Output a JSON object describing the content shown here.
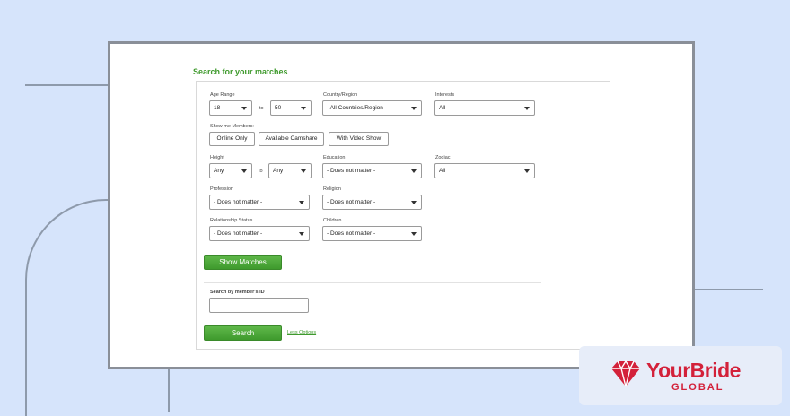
{
  "page": {
    "title": "Search for your matches"
  },
  "filters": {
    "age_range": {
      "label": "Age Range",
      "from": "18",
      "to_text": "to",
      "to": "50"
    },
    "country": {
      "label": "Country/Region",
      "value": "- All Countries/Region -"
    },
    "interests": {
      "label": "Interests",
      "value": "All"
    },
    "show_members": {
      "label": "Show me Members:",
      "options": [
        "Online Only",
        "Available Camshare",
        "With Video Show"
      ]
    },
    "height": {
      "label": "Height",
      "from": "Any",
      "to_text": "to",
      "to": "Any"
    },
    "education": {
      "label": "Education",
      "value": "- Does not matter -"
    },
    "zodiac": {
      "label": "Zodiac",
      "value": "All"
    },
    "profession": {
      "label": "Profession",
      "value": "- Does not matter -"
    },
    "religion": {
      "label": "Religion",
      "value": "- Does not matter -"
    },
    "relationship_status": {
      "label": "Relationship Status",
      "value": "- Does not matter -"
    },
    "children": {
      "label": "Children",
      "value": "- Does not matter -"
    },
    "show_matches_label": "Show Matches"
  },
  "member_search": {
    "label": "Search by member's ID",
    "value": "",
    "search_label": "Search",
    "less_options": "Less Options"
  },
  "brand": {
    "name": "YourBride",
    "sub": "GLOBAL",
    "color": "#d3213a",
    "icon": "diamond-icon"
  }
}
